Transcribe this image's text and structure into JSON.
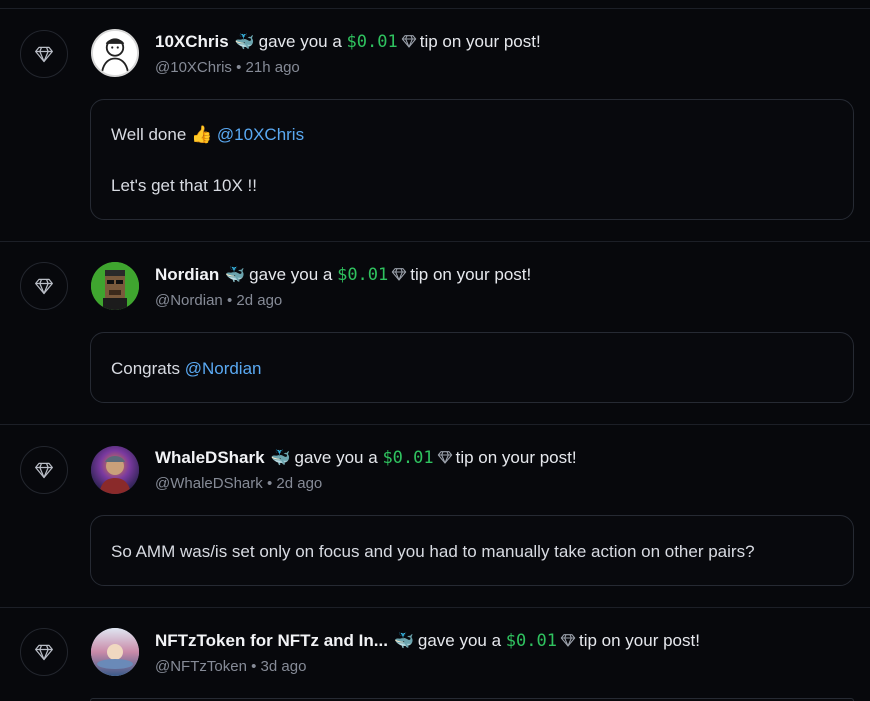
{
  "colors": {
    "background": "#07080c",
    "divider": "#1c1f27",
    "amount": "#2fc25f",
    "mention": "#5aa9f2",
    "muted": "#868b97"
  },
  "notifications": [
    {
      "name": "10XChris",
      "whale": "🐳",
      "action": "gave you a",
      "amount": "$0.01",
      "suffix": "tip on your post!",
      "handle": "@10XChris",
      "time": "21h ago",
      "message_lines": [
        {
          "text": "Well done 👍 ",
          "mention": "@10XChris"
        },
        {
          "text": "Let's get that 10X !!",
          "mention": ""
        }
      ]
    },
    {
      "name": "Nordian",
      "whale": "🐳",
      "action": "gave you a",
      "amount": "$0.01",
      "suffix": "tip on your post!",
      "handle": "@Nordian",
      "time": "2d ago",
      "message_lines": [
        {
          "text": "Congrats ",
          "mention": "@Nordian"
        }
      ]
    },
    {
      "name": "WhaleDShark",
      "whale": "🐳",
      "action": "gave you a",
      "amount": "$0.01",
      "suffix": "tip on your post!",
      "handle": "@WhaleDShark",
      "time": "2d ago",
      "message_lines": [
        {
          "text": "So AMM was/is set only on focus and you had to manually take action on other pairs?",
          "mention": ""
        }
      ]
    },
    {
      "name": "NFTzToken for NFTz and In...",
      "whale": "🐳",
      "action": "gave you a",
      "amount": "$0.01",
      "suffix": "tip on your post!",
      "handle": "@NFTzToken",
      "time": "3d ago",
      "message_lines": []
    }
  ],
  "separator": "•"
}
